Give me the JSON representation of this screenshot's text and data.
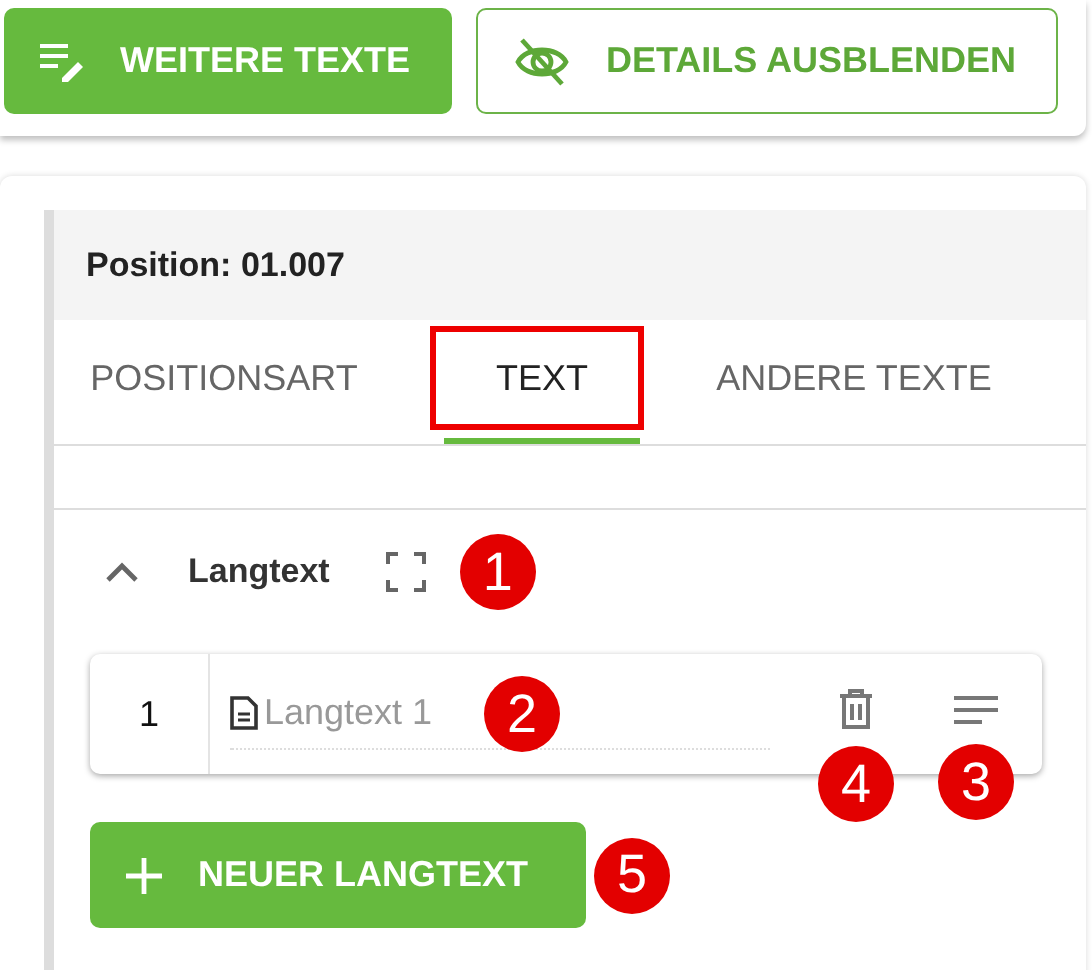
{
  "toolbar": {
    "buttons": [
      {
        "kind": "filled",
        "label": "WEITERE TEXTE"
      },
      {
        "kind": "outlined",
        "label": "DETAILS AUSBLENDEN"
      }
    ]
  },
  "position": {
    "title": "Position: 01.007",
    "tabs": [
      {
        "label": "POSITIONSART",
        "selected": false,
        "highlighted": false
      },
      {
        "label": "TEXT",
        "selected": true,
        "highlighted": true
      },
      {
        "label": "ANDERE TEXTE",
        "selected": false,
        "highlighted": false
      }
    ],
    "section": {
      "title": "Langtext",
      "expanded": true,
      "badge": "1",
      "entries": [
        {
          "number": "1",
          "placeholder": "Langtext 1",
          "badge": "2",
          "delete_badge": "4",
          "menu_badge": "3"
        }
      ],
      "add_button": {
        "label": "NEUER LANGTEXT",
        "badge": "5"
      }
    }
  }
}
